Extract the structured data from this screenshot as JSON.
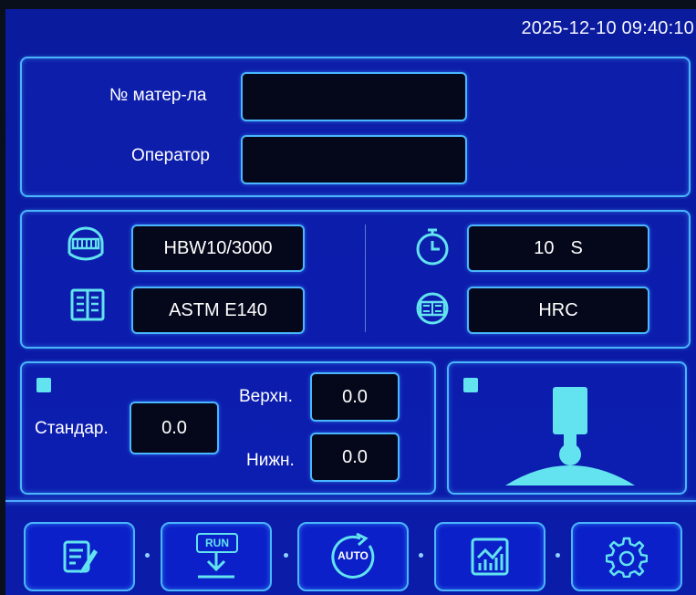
{
  "header": {
    "datetime": "2025-12-10 09:40:10"
  },
  "info_panel": {
    "material_label": "№ матер-ла",
    "material_value": "",
    "operator_label": "Оператор",
    "operator_value": ""
  },
  "params_panel": {
    "scale_value": "HBW10/3000",
    "standard_value": "ASTM E140",
    "dwell_value": "10",
    "dwell_unit": "S",
    "convert_value": "HRC"
  },
  "limits_panel": {
    "standard_label": "Стандар.",
    "standard_value": "0.0",
    "upper_label": "Верхн.",
    "upper_value": "0.0",
    "lower_label": "Нижн.",
    "lower_value": "0.0"
  },
  "nav": {
    "run_text": "RUN",
    "auto_text": "AUTO"
  },
  "colors": {
    "background": "#0b1b9e",
    "accent": "#49b6ff",
    "field": "#05081a",
    "indicator": "#62e3ef"
  }
}
